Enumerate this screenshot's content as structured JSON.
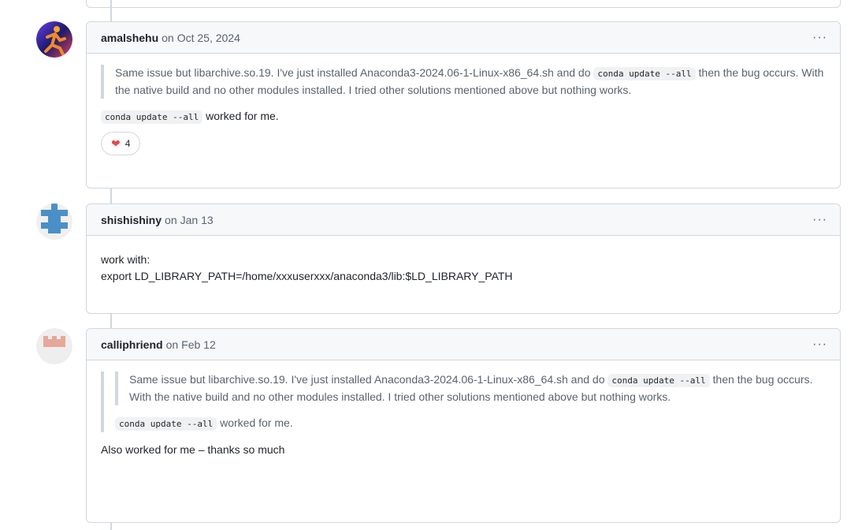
{
  "comments": [
    {
      "author": "amalshehu",
      "on": "on",
      "date": "Oct 25, 2024",
      "quote_part1": "Same issue but libarchive.so.19. I've just installed Anaconda3-2024.06-1-Linux-x86_64.sh and do",
      "quote_code": "conda update --all",
      "quote_part2": "then the bug occurs. With the native build and no other modules installed. I tried other solutions mentioned above but nothing works.",
      "body_code": "conda update --all",
      "body_text": "worked for me.",
      "reaction_count": "4",
      "reaction_icon": "heart-icon"
    },
    {
      "author": "shishishiny",
      "on": "on",
      "date": "Jan 13",
      "line1": "work with:",
      "line2": "export LD_LIBRARY_PATH=/home/xxxuserxxx/anaconda3/lib:$LD_LIBRARY_PATH"
    },
    {
      "author": "calliphriend",
      "on": "on",
      "date": "Feb 12",
      "quote_part1": "Same issue but libarchive.so.19. I've just installed Anaconda3-2024.06-1-Linux-x86_64.sh and do",
      "quote_code": "conda update --all",
      "quote_part2": "then the bug occurs. With the native build and no other modules installed. I tried other solutions mentioned above but nothing works.",
      "quote_code2": "conda update --all",
      "quote_text2": "worked for me.",
      "body_text": "Also worked for me – thanks so much"
    }
  ],
  "menu_label": "···"
}
